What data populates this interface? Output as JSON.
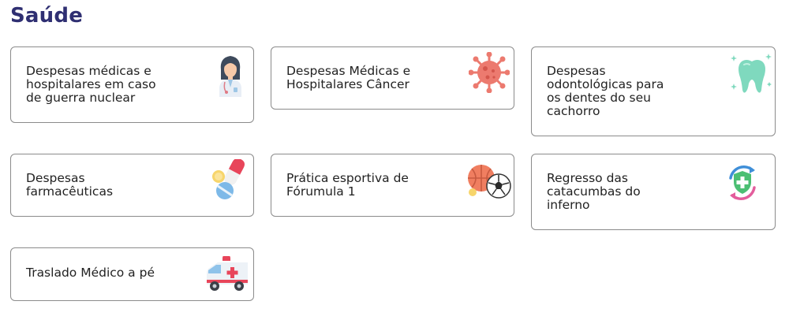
{
  "section": {
    "title": "Saúde"
  },
  "cards": [
    {
      "lines": [
        "Despesas médicas e",
        "hospitalares em caso",
        "de guerra nuclear"
      ],
      "icon": "doctor-icon"
    },
    {
      "lines": [
        "Despesas Médicas e",
        "Hospitalares Câncer"
      ],
      "icon": "virus-icon"
    },
    {
      "lines": [
        "Despesas",
        "odontológicas para",
        "os dentes do seu",
        "cachorro"
      ],
      "icon": "tooth-icon"
    },
    {
      "lines": [
        "Despesas",
        "farmacêuticas"
      ],
      "icon": "pills-icon"
    },
    {
      "lines": [
        "Prática esportiva de",
        "Fórumula 1"
      ],
      "icon": "sports-balls-icon"
    },
    {
      "lines": [
        "Regresso das",
        "catacumbas do",
        "inferno"
      ],
      "icon": "health-shield-icon"
    },
    {
      "lines": [
        "Traslado Médico a pé"
      ],
      "icon": "ambulance-icon"
    }
  ]
}
